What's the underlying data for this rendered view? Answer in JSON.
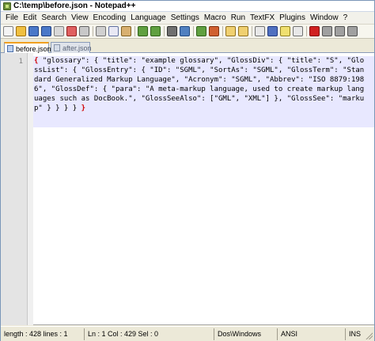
{
  "window": {
    "title": "C:\\temp\\before.json - Notepad++"
  },
  "menu": {
    "items": [
      "File",
      "Edit",
      "Search",
      "View",
      "Encoding",
      "Language",
      "Settings",
      "Macro",
      "Run",
      "TextFX",
      "Plugins",
      "Window",
      "?"
    ]
  },
  "toolbar": {
    "buttons": [
      {
        "name": "new-file-icon",
        "color": "#f4f4f4",
        "border": "#808080"
      },
      {
        "name": "open-file-icon",
        "color": "#f0c040",
        "border": "#a07010"
      },
      {
        "name": "save-icon",
        "color": "#4a78c8",
        "border": "#1f3f80"
      },
      {
        "name": "save-all-icon",
        "color": "#4a78c8",
        "border": "#1f3f80"
      },
      {
        "name": "close-icon",
        "color": "#d8d8d8",
        "border": "#808080"
      },
      {
        "name": "close-all-icon",
        "color": "#e06060",
        "border": "#902020"
      },
      {
        "name": "print-icon",
        "color": "#c8c8c8",
        "border": "#606060"
      },
      {
        "sep": true
      },
      {
        "name": "cut-icon",
        "color": "#d0d0d0",
        "border": "#707070"
      },
      {
        "name": "copy-icon",
        "color": "#e8e8f4",
        "border": "#6070a0"
      },
      {
        "name": "paste-icon",
        "color": "#d8b070",
        "border": "#806020"
      },
      {
        "sep": true
      },
      {
        "name": "undo-icon",
        "color": "#60a040",
        "border": "#2f6018"
      },
      {
        "name": "redo-icon",
        "color": "#60a040",
        "border": "#2f6018"
      },
      {
        "sep": true
      },
      {
        "name": "find-icon",
        "color": "#707070",
        "border": "#303030"
      },
      {
        "name": "replace-icon",
        "color": "#5080c0",
        "border": "#204880"
      },
      {
        "sep": true
      },
      {
        "name": "zoom-in-icon",
        "color": "#60a040",
        "border": "#2f6018"
      },
      {
        "name": "zoom-out-icon",
        "color": "#d06030",
        "border": "#803010"
      },
      {
        "sep": true
      },
      {
        "name": "sync-vertical-icon",
        "color": "#f0d070",
        "border": "#907020"
      },
      {
        "name": "sync-horizontal-icon",
        "color": "#f0d070",
        "border": "#907020"
      },
      {
        "sep": true
      },
      {
        "name": "word-wrap-icon",
        "color": "#e8e8e8",
        "border": "#707070"
      },
      {
        "name": "show-all-chars-icon",
        "color": "#5070c0",
        "border": "#203880"
      },
      {
        "name": "indent-guide-icon",
        "color": "#f0e070",
        "border": "#908020"
      },
      {
        "name": "user-language-icon",
        "color": "#e8e8e8",
        "border": "#707070"
      },
      {
        "sep": true
      },
      {
        "name": "record-macro-icon",
        "color": "#d02020",
        "border": "#801010"
      },
      {
        "name": "stop-record-icon",
        "color": "#a0a0a0",
        "border": "#505050"
      },
      {
        "name": "play-macro-icon",
        "color": "#a0a0a0",
        "border": "#505050"
      },
      {
        "name": "play-multiple-icon",
        "color": "#a0a0a0",
        "border": "#505050"
      }
    ]
  },
  "tabs": [
    {
      "label": "before.json",
      "active": true
    },
    {
      "label": "after.json",
      "active": false
    }
  ],
  "editor": {
    "line_number": "1",
    "open_brace": "{",
    "code": " \"glossary\": { \"title\": \"example glossary\", \"GlossDiv\": { \"title\": \"S\", \"GlossList\": { \"GlossEntry\": { \"ID\": \"SGML\", \"SortAs\": \"SGML\", \"GlossTerm\": \"Standard Generalized Markup Language\", \"Acronym\": \"SGML\", \"Abbrev\": \"ISO 8879:1986\", \"GlossDef\": { \"para\": \"A meta-markup language, used to create markup languages such as DocBook.\", \"GlossSeeAlso\": [\"GML\", \"XML\"] }, \"GlossSee\": \"markup\" } } } } ",
    "close_brace": "}"
  },
  "status": {
    "length_lines": "length : 428    lines : 1",
    "position": "Ln : 1    Col : 429    Sel : 0",
    "eol": "Dos\\Windows",
    "encoding": "ANSI",
    "mode": "INS"
  }
}
